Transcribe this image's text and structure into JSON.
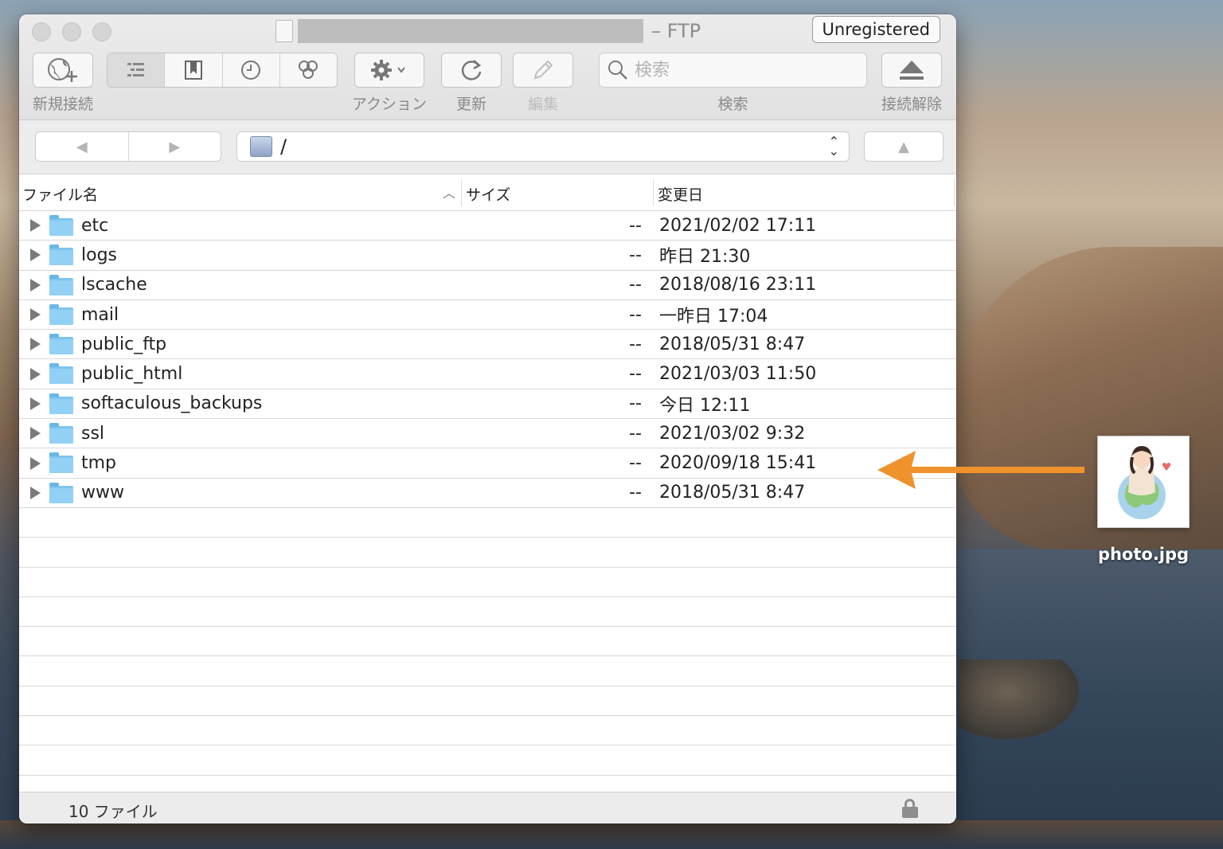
{
  "window": {
    "title_suffix": "– FTP",
    "unregistered_label": "Unregistered"
  },
  "toolbar": {
    "new_connection_label": "新規接続",
    "action_label": "アクション",
    "refresh_label": "更新",
    "edit_label": "編集",
    "search_label": "検索",
    "search_placeholder": "検索",
    "disconnect_label": "接続解除"
  },
  "navigation": {
    "path": "/"
  },
  "columns": {
    "filename": "ファイル名",
    "size": "サイズ",
    "modified": "変更日"
  },
  "files": [
    {
      "name": "etc",
      "size": "--",
      "date": "2021/02/02 17:11"
    },
    {
      "name": "logs",
      "size": "--",
      "date": "昨日 21:30"
    },
    {
      "name": "lscache",
      "size": "--",
      "date": "2018/08/16 23:11"
    },
    {
      "name": "mail",
      "size": "--",
      "date": "一昨日 17:04"
    },
    {
      "name": "public_ftp",
      "size": "--",
      "date": "2018/05/31 8:47"
    },
    {
      "name": "public_html",
      "size": "--",
      "date": "2021/03/03 11:50"
    },
    {
      "name": "softaculous_backups",
      "size": "--",
      "date": "今日 12:11"
    },
    {
      "name": "ssl",
      "size": "--",
      "date": "2021/03/02 9:32"
    },
    {
      "name": "tmp",
      "size": "--",
      "date": "2020/09/18 15:41"
    },
    {
      "name": "www",
      "size": "--",
      "date": "2018/05/31 8:47"
    }
  ],
  "status": {
    "file_count": "10 ファイル"
  },
  "desktop": {
    "file_name": "photo.jpg",
    "arrow_color": "#f0922b"
  }
}
